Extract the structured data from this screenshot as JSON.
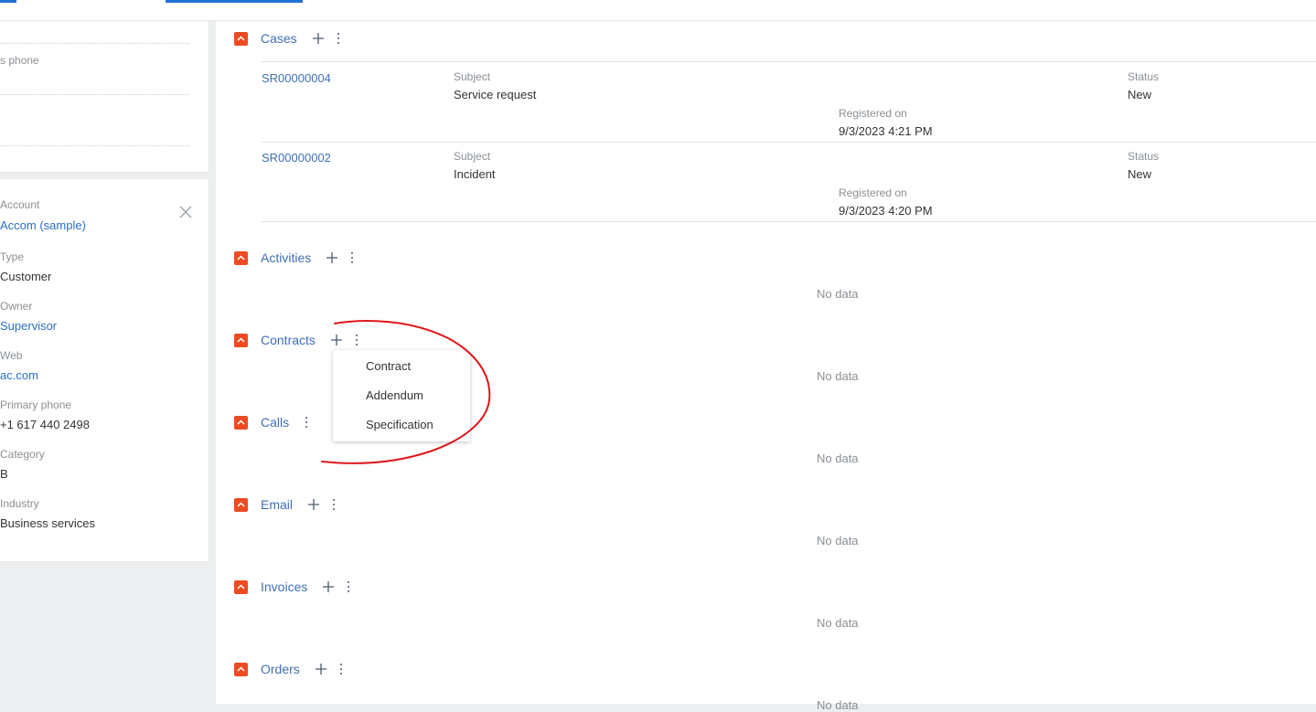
{
  "left_panel": {
    "card1": {
      "partial_label": "s phone"
    },
    "account_card": {
      "fields": [
        {
          "label": "Account",
          "value": "Accom (sample)",
          "link": true
        },
        {
          "label": "Type",
          "value": "Customer",
          "link": false
        },
        {
          "label": "Owner",
          "value": "Supervisor",
          "link": true
        },
        {
          "label": "Web",
          "value": "ac.com",
          "link": true
        },
        {
          "label": "Primary phone",
          "value": "+1 617 440 2498",
          "link": false
        },
        {
          "label": "Category",
          "value": "B",
          "link": false
        },
        {
          "label": "Industry",
          "value": "Business services",
          "link": false
        }
      ]
    }
  },
  "sections": {
    "cases": {
      "title": "Cases"
    },
    "activities": {
      "title": "Activities",
      "empty": "No data"
    },
    "contracts": {
      "title": "Contracts",
      "empty": "No data"
    },
    "calls": {
      "title": "Calls",
      "empty": "No data"
    },
    "email": {
      "title": "Email",
      "empty": "No data"
    },
    "invoices": {
      "title": "Invoices",
      "empty": "No data"
    },
    "orders": {
      "title": "Orders",
      "empty": "No data"
    }
  },
  "cases": [
    {
      "id": "SR00000004",
      "subject_label": "Subject",
      "subject": "Service request",
      "registered_label": "Registered on",
      "registered": "9/3/2023 4:21 PM",
      "status_label": "Status",
      "status": "New"
    },
    {
      "id": "SR00000002",
      "subject_label": "Subject",
      "subject": "Incident",
      "registered_label": "Registered on",
      "registered": "9/3/2023 4:20 PM",
      "status_label": "Status",
      "status": "New"
    }
  ],
  "contracts_menu": {
    "items": [
      "Contract",
      "Addendum",
      "Specification"
    ]
  },
  "colors": {
    "accent": "#f04a22",
    "link": "#3f6fb5",
    "annotation": "#e0161b"
  }
}
